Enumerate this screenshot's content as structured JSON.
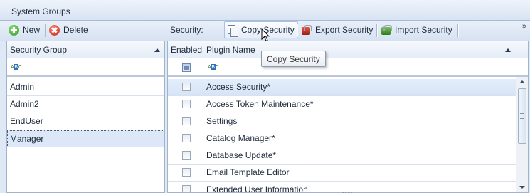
{
  "window": {
    "title": "System Groups"
  },
  "toolbar": {
    "new_label": "New",
    "delete_label": "Delete",
    "security_label": "Security:",
    "copy_security_label": "Copy Security",
    "export_security_label": "Export Security",
    "import_security_label": "Import Security",
    "overflow_glyph": "»"
  },
  "groups_grid": {
    "header": "Security Group",
    "rows": [
      "Admin",
      "Admin2",
      "EndUser",
      "Manager"
    ],
    "selected": "Manager"
  },
  "plugins_grid": {
    "col_enabled": "Enabled",
    "col_plugin": "Plugin Name",
    "rows": [
      {
        "name": "Access Security*",
        "enabled": false
      },
      {
        "name": "Access Token Maintenance*",
        "enabled": false
      },
      {
        "name": "Settings",
        "enabled": false
      },
      {
        "name": "Catalog Manager*",
        "enabled": false
      },
      {
        "name": "Database Update*",
        "enabled": false
      },
      {
        "name": "Email Template Editor",
        "enabled": false
      },
      {
        "name": "Extended User Information",
        "enabled": false
      }
    ]
  },
  "tooltip": {
    "text": "Copy Security"
  },
  "icons": {
    "new": "add-circle-icon",
    "delete": "delete-circle-icon",
    "copy": "copy-icon",
    "export": "export-briefcase-icon",
    "import": "import-briefcase-icon",
    "filter": "abc-filter-icon"
  },
  "colors": {
    "selection": "#dce8f7",
    "header_bg": "#e4ecf7",
    "border": "#a2b4cc"
  }
}
